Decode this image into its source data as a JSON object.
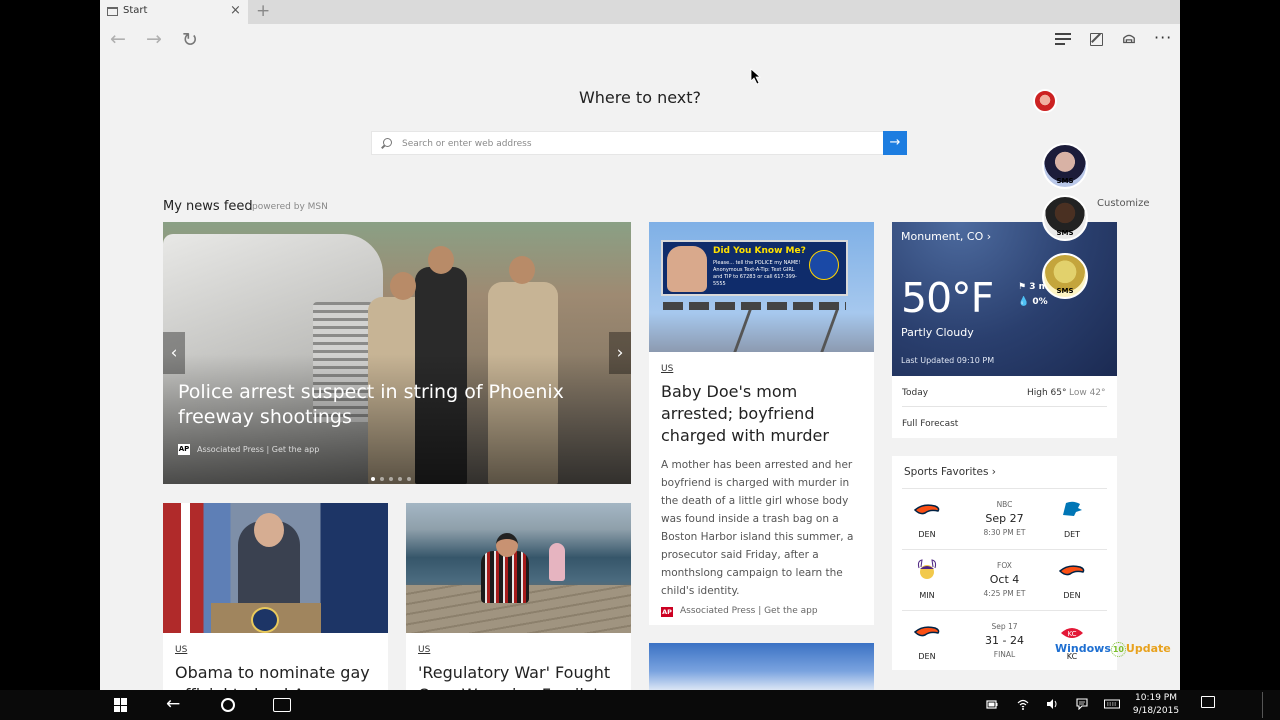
{
  "browser": {
    "tab_title": "Start",
    "new_tab": "+",
    "close": "×"
  },
  "start": {
    "heading": "Where to next?",
    "search_placeholder": "Search or enter web address",
    "go": "→",
    "feed_title": "My news feed",
    "feed_powered": "powered by MSN",
    "customize": "Customize"
  },
  "hero": {
    "title": "Police arrest suspect in string of Phoenix freeway shootings",
    "source_icon": "AP",
    "source": "Associated Press | Get the app",
    "prev": "‹",
    "next": "›"
  },
  "card_baby": {
    "billboard_title": "Did You Know Me?",
    "billboard_text": "Please... tell the POLICE my NAME! Anonymous Text-A-Tip: Text GIRL and TIP to 67283 or call 617-399-5555",
    "category": "US",
    "headline": "Baby Doe's mom arrested; boyfriend charged with murder",
    "body": "A mother has been arrested and her boyfriend is charged with murder in the death of a little girl whose body was found inside a trash bag on a Boston Harbor island this summer, a prosecutor said Friday, after a monthslong campaign to learn the child's identity.",
    "source_icon": "AP",
    "source": "Associated Press | Get the app"
  },
  "card_obama": {
    "category": "US",
    "headline": "Obama to nominate gay official to lead Army"
  },
  "card_war": {
    "category": "US",
    "headline": "'Regulatory War' Fought Over Wyoming Family's"
  },
  "weather": {
    "location": "Monument, CO",
    "temp": "50°F",
    "wind": "3 mph",
    "precip": "0%",
    "condition": "Partly Cloudy",
    "updated": "Last Updated 09:10 PM",
    "today": "Today",
    "high": "High 65°",
    "low": "Low 42°",
    "full_forecast": "Full Forecast"
  },
  "sports": {
    "title": "Sports Favorites",
    "games": [
      {
        "home": "DEN",
        "away": "DET",
        "network": "NBC",
        "date": "Sep 27",
        "time": "8:30 PM ET"
      },
      {
        "home": "MIN",
        "away": "DEN",
        "network": "FOX",
        "date": "Oct 4",
        "time": "4:25 PM ET"
      },
      {
        "home": "DEN",
        "away": "KC",
        "network": "Sep 17",
        "date": "31 - 24",
        "time": "FINAL"
      }
    ]
  },
  "overlays": {
    "sms": "SMS",
    "watermark_left": "Windows",
    "watermark_num": "10",
    "watermark_right": "Update"
  },
  "taskbar": {
    "time": "10:19 PM",
    "date": "9/18/2015"
  },
  "colors": {
    "accent": "#1d7de0",
    "weather_bg": "#2a3f6e",
    "taskbar": "#0a0a0a"
  }
}
